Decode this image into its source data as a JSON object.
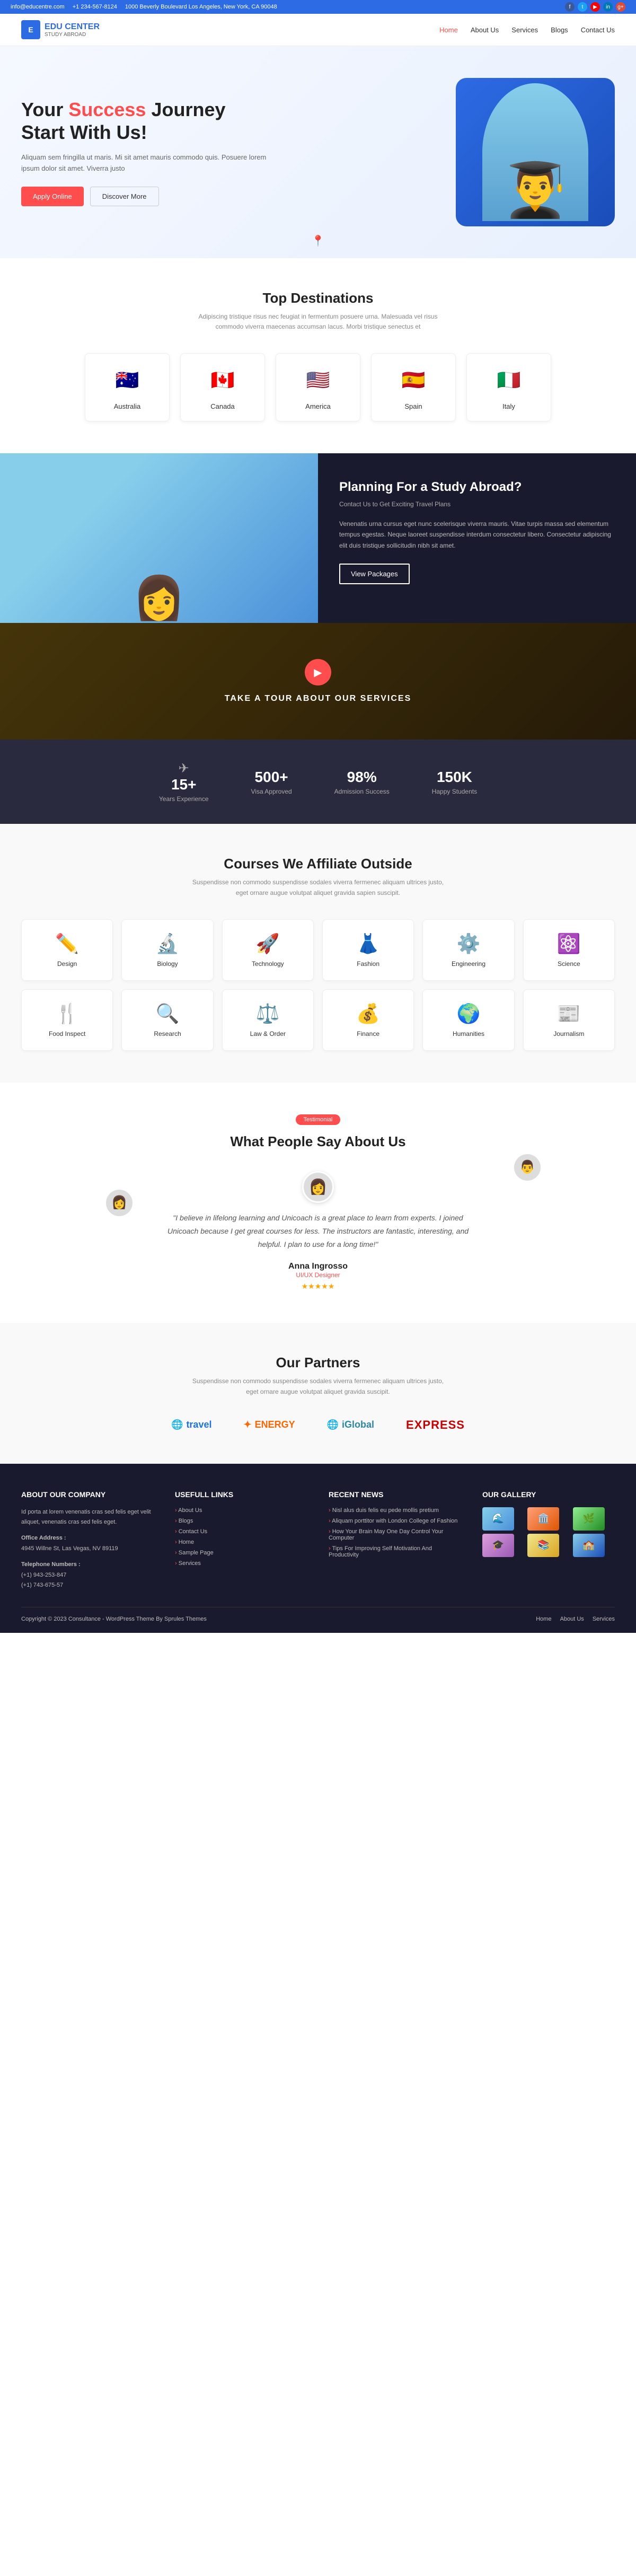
{
  "topbar": {
    "email": "info@educentre.com",
    "phone": "+1 234-567-8124",
    "address": "1000 Beverly Boulevard Los Angeles, New York, CA 90048",
    "socials": [
      "fb",
      "tw",
      "yt",
      "li",
      "gp"
    ]
  },
  "header": {
    "logo_text": "EDU CENTER",
    "logo_sub": "STUDY ABROAD",
    "nav": [
      {
        "label": "Home",
        "active": true
      },
      {
        "label": "About Us",
        "active": false
      },
      {
        "label": "Services",
        "active": false
      },
      {
        "label": "Blogs",
        "active": false
      },
      {
        "label": "Contact Us",
        "active": false
      }
    ]
  },
  "hero": {
    "title_pre": "Your ",
    "title_accent": "Success",
    "title_post": " Journey Start With Us!",
    "description": "Aliquam sem fringilla ut maris. Mi sit amet mauris commodo quis. Posuere lorem ipsum dolor sit amet. Viverra justo",
    "btn_primary": "Apply Online",
    "btn_secondary": "Discover More"
  },
  "destinations": {
    "section_title": "Top Destinations",
    "section_subtitle": "Adipiscing tristique risus nec feugiat in fermentum posuere urna. Malesuada vel risus commodo viverra maecenas accumsan lacus. Morbi tristique senectus et",
    "items": [
      {
        "name": "Australia",
        "emoji": "🇦🇺"
      },
      {
        "name": "Canada",
        "emoji": "🇨🇦"
      },
      {
        "name": "America",
        "emoji": "🇺🇸"
      },
      {
        "name": "Spain",
        "emoji": "🇪🇸"
      },
      {
        "name": "Italy",
        "emoji": "🇮🇹"
      }
    ]
  },
  "study_abroad": {
    "title": "Planning For a Study Abroad?",
    "contact_line": "Contact Us to Get Exciting Travel Plans",
    "description": "Venenatis urna cursus eget nunc scelerisque viverra mauris. Vitae turpis massa sed elementum tempus egestas. Neque laoreet suspendisse interdum consectetur libero. Consectetur adipiscing elit duis tristique sollicitudin nibh sit amet.",
    "btn_label": "View Packages"
  },
  "video_banner": {
    "title": "TAKE A TOUR ABOUT OUR SERVICES",
    "play_icon": "▶"
  },
  "stats": [
    {
      "number": "15+",
      "label": "Years Experience"
    },
    {
      "number": "500+",
      "label": "Visa Approved"
    },
    {
      "number": "98%",
      "label": "Admission Success"
    },
    {
      "number": "150K",
      "label": "Happy Students"
    }
  ],
  "courses": {
    "section_title": "Courses We Affiliate Outside",
    "section_subtitle": "Suspendisse non commodo suspendisse sodales viverra fermenec aliquam ultrices justo, eget ornare augue volutpat aliquet gravida sapien suscipit.",
    "items": [
      {
        "name": "Design",
        "icon": "✏️"
      },
      {
        "name": "Biology",
        "icon": "🔬"
      },
      {
        "name": "Technology",
        "icon": "🚀"
      },
      {
        "name": "Fashion",
        "icon": "👗"
      },
      {
        "name": "Engineering",
        "icon": "⚙️"
      },
      {
        "name": "Science",
        "icon": "⚛️"
      },
      {
        "name": "Food Inspect",
        "icon": "🍴"
      },
      {
        "name": "Research",
        "icon": "🔍"
      },
      {
        "name": "Law & Order",
        "icon": "⚖️"
      },
      {
        "name": "Finance",
        "icon": "💰"
      },
      {
        "name": "Humanities",
        "icon": "🌍"
      },
      {
        "name": "Journalism",
        "icon": "📰"
      }
    ]
  },
  "testimonial": {
    "badge": "Testimonial",
    "section_title": "What People Say About Us",
    "quote": "\"I believe in lifelong learning and Unicoach is a great place to learn from experts. I joined Unicoach because I get great courses for less. The instructors are fantastic, interesting, and helpful. I plan to use for a long time!\"",
    "name": "Anna Ingrosso",
    "role": "UI/UX Designer",
    "stars": "★★★★★"
  },
  "partners": {
    "section_title": "Our Partners",
    "section_subtitle": "Suspendisse non commodo suspendisse sodales viverra fermenec aliquam ultrices justo, eget ornare augue volutpat aliquet gravida suscipit.",
    "items": [
      {
        "name": "travel",
        "prefix": "🌐",
        "color": "#1a73e8"
      },
      {
        "name": "ENERGY",
        "prefix": "✦",
        "color": "#ff6600"
      },
      {
        "name": "iGlobal",
        "prefix": "🌐",
        "color": "#2e86ab"
      },
      {
        "name": "EXPRESS",
        "prefix": "",
        "color": "#cc0000"
      }
    ]
  },
  "footer": {
    "about_title": "ABOUT OUR COMPANY",
    "about_text": "Id porta at lorem venenatis cras sed felis eget velit aliquet, venenatis cras sed felis eget.",
    "office_label": "Office Address :",
    "office_address": "4945 Willne St, Las Vegas, NV 89119",
    "phone_label": "Telephone Numbers :",
    "phone1": "(+1) 943-253-847",
    "phone2": "(+1) 743-675-57",
    "useful_links_title": "USEFULL LINKS",
    "useful_links": [
      "About Us",
      "Blogs",
      "Contact Us",
      "Home",
      "Sample Page",
      "Services"
    ],
    "recent_news_title": "RECENT NEWS",
    "recent_news": [
      "Nisl alus duis felis eu pede mollis pretium",
      "Aliquam porttitor with London College of Fashion",
      "How Your Brain May One Day Control Your Computer",
      "Tips For Improving Self Motivation And Productivity"
    ],
    "gallery_title": "OUR GALLERY",
    "copyright": "Copyright © 2023 Consultance - WordPress Theme  By Sprules Themes",
    "footer_nav": [
      "Home",
      "About Us",
      "Services"
    ]
  }
}
